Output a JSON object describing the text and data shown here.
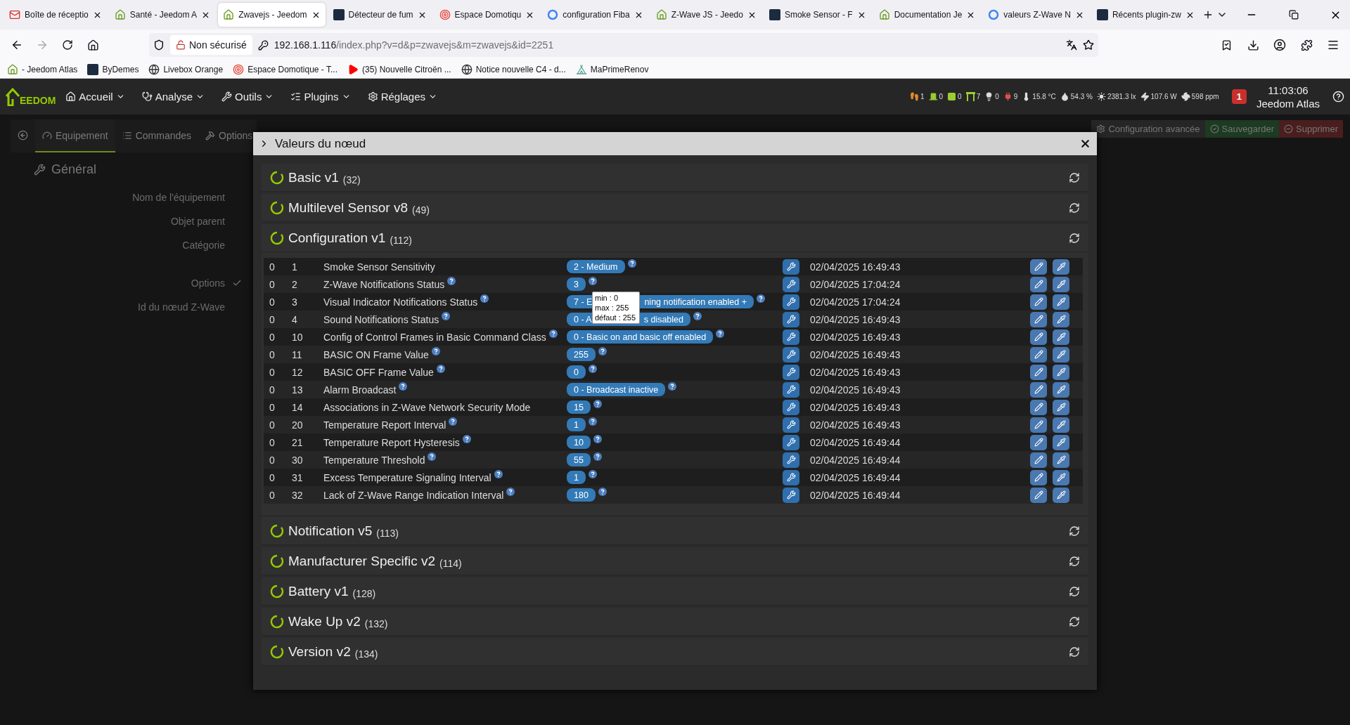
{
  "browser": {
    "tabs": [
      {
        "title": "Boîte de réceptio",
        "kind": "mail",
        "selected": false
      },
      {
        "title": "Santé - Jeedom A",
        "kind": "house",
        "selected": false
      },
      {
        "title": "Zwavejs - Jeedom",
        "kind": "house",
        "selected": true
      },
      {
        "title": "Détecteur de fum",
        "kind": "square",
        "selected": false
      },
      {
        "title": "Espace Domotiqu",
        "kind": "target",
        "selected": false
      },
      {
        "title": "configuration Fiba",
        "kind": "ring",
        "selected": false
      },
      {
        "title": "Z-Wave JS - Jeedo",
        "kind": "house",
        "selected": false
      },
      {
        "title": "Smoke Sensor - F",
        "kind": "square",
        "selected": false
      },
      {
        "title": "Documentation Je",
        "kind": "house",
        "selected": false
      },
      {
        "title": "valeurs Z-Wave N",
        "kind": "ring",
        "selected": false
      },
      {
        "title": "Récents plugin-zw",
        "kind": "square",
        "selected": false
      }
    ],
    "security": "Non sécurisé",
    "url": {
      "host": "192.168.1.116",
      "path": "/index.php?v=d&p=zwavejs&m=zwavejs&id=2251"
    },
    "bookmarks": [
      {
        "label": "- Jeedom Atlas",
        "kind": "house"
      },
      {
        "label": "ByDemes",
        "kind": "square"
      },
      {
        "label": "Livebox Orange",
        "kind": "globe"
      },
      {
        "label": "Espace Domotique - T...",
        "kind": "target"
      },
      {
        "label": "(35) Nouvelle Citroën ...",
        "kind": "play"
      },
      {
        "label": "Notice nouvelle C4 - d...",
        "kind": "globe"
      },
      {
        "label": "MaPrimeRenov",
        "kind": "tent"
      }
    ]
  },
  "nav": {
    "logo": "EEDOM",
    "menus": [
      {
        "label": "Accueil",
        "kind": "house"
      },
      {
        "label": "Analyse",
        "kind": "stethoscope"
      },
      {
        "label": "Outils",
        "kind": "wrench"
      },
      {
        "label": "Plugins",
        "kind": "list"
      },
      {
        "label": "Réglages",
        "kind": "gear"
      }
    ],
    "status": [
      {
        "kind": "walker",
        "value": "1",
        "color": "#e08a2a"
      },
      {
        "kind": "door",
        "value": "0",
        "color": "#9acd32"
      },
      {
        "kind": "window",
        "value": "0",
        "color": "#9acd32"
      },
      {
        "kind": "shutter",
        "value": "7",
        "color": "#9acd32"
      },
      {
        "kind": "bulb",
        "value": "0",
        "color": "#dddddd"
      },
      {
        "kind": "plug",
        "value": "9",
        "color": "#d9534f"
      },
      {
        "kind": "thermometer",
        "value": "15.8 °C",
        "color": "#dddddd"
      },
      {
        "kind": "drop",
        "value": "54.3 %",
        "color": "#dddddd"
      },
      {
        "kind": "sun",
        "value": "2381.3 lx",
        "color": "#dddddd"
      },
      {
        "kind": "bolt",
        "value": "107.6 W",
        "color": "#dddddd"
      },
      {
        "kind": "fan",
        "value": "598 ppm",
        "color": "#dddddd"
      }
    ],
    "notifications": "1",
    "time": "11:03:06",
    "user": "Jeedom Atlas"
  },
  "page": {
    "tabs": [
      {
        "label": "Equipement",
        "kind": "gauge",
        "selected": true
      },
      {
        "label": "Commandes",
        "kind": "list",
        "selected": false
      },
      {
        "label": "Options",
        "kind": "tools",
        "selected": false
      }
    ],
    "actions": [
      {
        "label": "Configuration avancée",
        "kind": "config"
      },
      {
        "label": "Sauvegarder",
        "kind": "save"
      },
      {
        "label": "Supprimer",
        "kind": "delete"
      }
    ],
    "section": "Général",
    "fields": [
      {
        "label": "Nom de l'équipement",
        "kind": "text"
      },
      {
        "label": "Objet parent",
        "kind": "text"
      },
      {
        "label": "Catégorie",
        "kind": "text"
      },
      {
        "label": "Options",
        "kind": "check"
      },
      {
        "label": "Id du nœud Z-Wave",
        "kind": "text"
      }
    ]
  },
  "modal": {
    "title": "Valeurs du nœud",
    "sections": [
      {
        "name": "Basic v1",
        "count": "(32)"
      },
      {
        "name": "Multilevel Sensor v8",
        "count": "(49)"
      },
      {
        "name": "Configuration v1",
        "count": "(112)",
        "rows": [
          {
            "instance": "0",
            "param": "1",
            "label": "Smoke Sensor Sensitivity",
            "help": false,
            "value": [
              "2 - Medium"
            ],
            "date": "02/04/2025 16:49:43"
          },
          {
            "instance": "0",
            "param": "2",
            "label": "Z-Wave Notifications Status",
            "help": true,
            "value": [
              "3"
            ],
            "date": "02/04/2025 17:04:24"
          },
          {
            "instance": "0",
            "param": "3",
            "label": "Visual Indicator Notifications Status",
            "help": true,
            "value": [
              "7 - E",
              "ning notification enabled +"
            ],
            "date": "02/04/2025 17:04:24",
            "tooltip": [
              "min : 0",
              "max : 255",
              "défaut : 255"
            ]
          },
          {
            "instance": "0",
            "param": "4",
            "label": "Sound Notifications Status",
            "help": true,
            "value": [
              "0 - A",
              "s disabled"
            ],
            "date": "02/04/2025 16:49:43"
          },
          {
            "instance": "0",
            "param": "10",
            "label": "Config of Control Frames in Basic Command Class",
            "help": true,
            "value": [
              "0 - Basic on and basic off enabled"
            ],
            "date": "02/04/2025 16:49:43"
          },
          {
            "instance": "0",
            "param": "11",
            "label": "BASIC ON Frame Value",
            "help": true,
            "value": [
              "255"
            ],
            "date": "02/04/2025 16:49:43"
          },
          {
            "instance": "0",
            "param": "12",
            "label": "BASIC OFF Frame Value",
            "help": true,
            "value": [
              "0"
            ],
            "date": "02/04/2025 16:49:43"
          },
          {
            "instance": "0",
            "param": "13",
            "label": "Alarm Broadcast",
            "help": true,
            "value": [
              "0 - Broadcast inactive"
            ],
            "date": "02/04/2025 16:49:43"
          },
          {
            "instance": "0",
            "param": "14",
            "label": "Associations in Z-Wave Network Security Mode",
            "help": false,
            "value": [
              "15"
            ],
            "date": "02/04/2025 16:49:43"
          },
          {
            "instance": "0",
            "param": "20",
            "label": "Temperature Report Interval",
            "help": true,
            "value": [
              "1"
            ],
            "date": "02/04/2025 16:49:43"
          },
          {
            "instance": "0",
            "param": "21",
            "label": "Temperature Report Hysteresis",
            "help": true,
            "value": [
              "10"
            ],
            "date": "02/04/2025 16:49:44"
          },
          {
            "instance": "0",
            "param": "30",
            "label": "Temperature Threshold",
            "help": true,
            "value": [
              "55"
            ],
            "date": "02/04/2025 16:49:44"
          },
          {
            "instance": "0",
            "param": "31",
            "label": "Excess Temperature Signaling Interval",
            "help": true,
            "value": [
              "1"
            ],
            "date": "02/04/2025 16:49:44"
          },
          {
            "instance": "0",
            "param": "32",
            "label": "Lack of Z-Wave Range Indication Interval",
            "help": true,
            "value": [
              "180"
            ],
            "date": "02/04/2025 16:49:44"
          }
        ]
      },
      {
        "name": "Notification v5",
        "count": "(113)"
      },
      {
        "name": "Manufacturer Specific v2",
        "count": "(114)"
      },
      {
        "name": "Battery v1",
        "count": "(128)"
      },
      {
        "name": "Wake Up v2",
        "count": "(132)"
      },
      {
        "name": "Version v2",
        "count": "(134)"
      }
    ]
  }
}
